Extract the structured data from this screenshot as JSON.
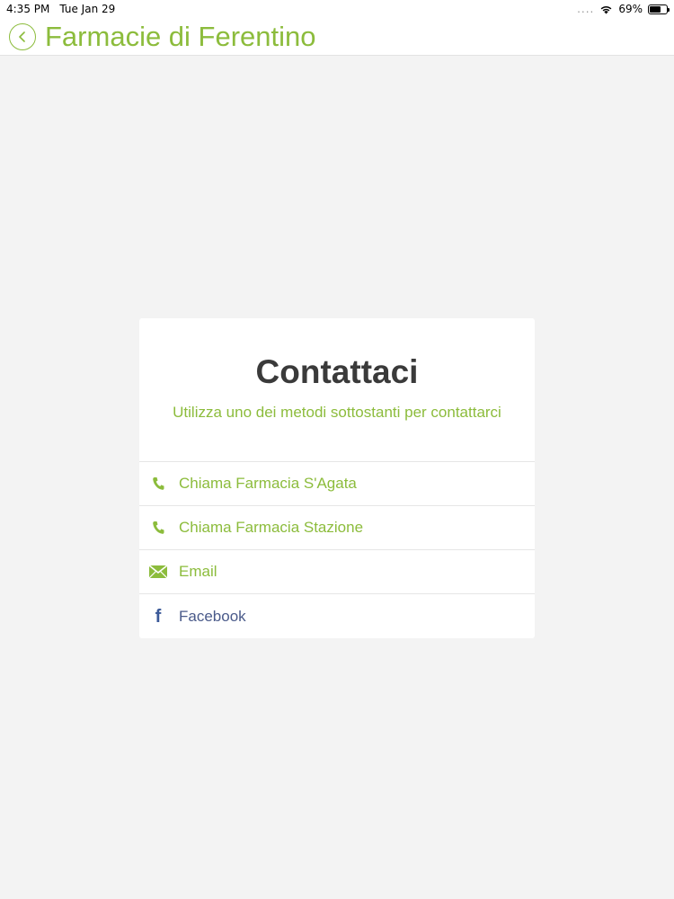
{
  "status_bar": {
    "time": "4:35 PM",
    "date": "Tue Jan 29",
    "signal": "....",
    "battery": "69%",
    "battery_level": 0.69
  },
  "nav": {
    "title": "Farmacie di Ferentino",
    "back_icon": "chevron-left-icon"
  },
  "card": {
    "title": "Contattaci",
    "subtitle": "Utilizza uno dei metodi sottostanti per contattarci",
    "items": [
      {
        "label": "Chiama Farmacia S'Agata",
        "icon": "phone-icon"
      },
      {
        "label": "Chiama Farmacia Stazione",
        "icon": "phone-icon"
      },
      {
        "label": "Email",
        "icon": "envelope-icon"
      },
      {
        "label": "Facebook",
        "icon": "facebook-icon"
      }
    ]
  },
  "colors": {
    "accent": "#8cbc3c",
    "background": "#f3f3f3",
    "title_text": "#3a3a3a",
    "facebook": "#3b5998"
  }
}
